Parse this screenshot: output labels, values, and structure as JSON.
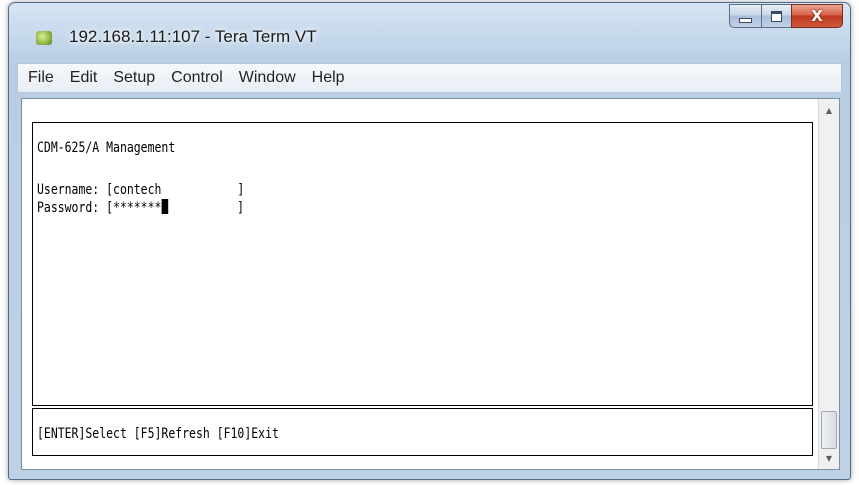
{
  "window": {
    "title": "192.168.1.11:107 - Tera Term VT",
    "close_glyph": "X"
  },
  "menu": {
    "items": [
      {
        "label": "File"
      },
      {
        "label": "Edit"
      },
      {
        "label": "Setup"
      },
      {
        "label": "Control"
      },
      {
        "label": "Window"
      },
      {
        "label": "Help"
      }
    ]
  },
  "terminal": {
    "header": "CDM-625/A Management",
    "username_line": "Username: [contech           ]",
    "password_prefix": "Password: [",
    "password_value": "*******",
    "password_suffix": "          ]",
    "footer": "[ENTER]Select [F5]Refresh [F10]Exit"
  },
  "scrollbar": {
    "up_glyph": "▲",
    "down_glyph": "▼"
  }
}
